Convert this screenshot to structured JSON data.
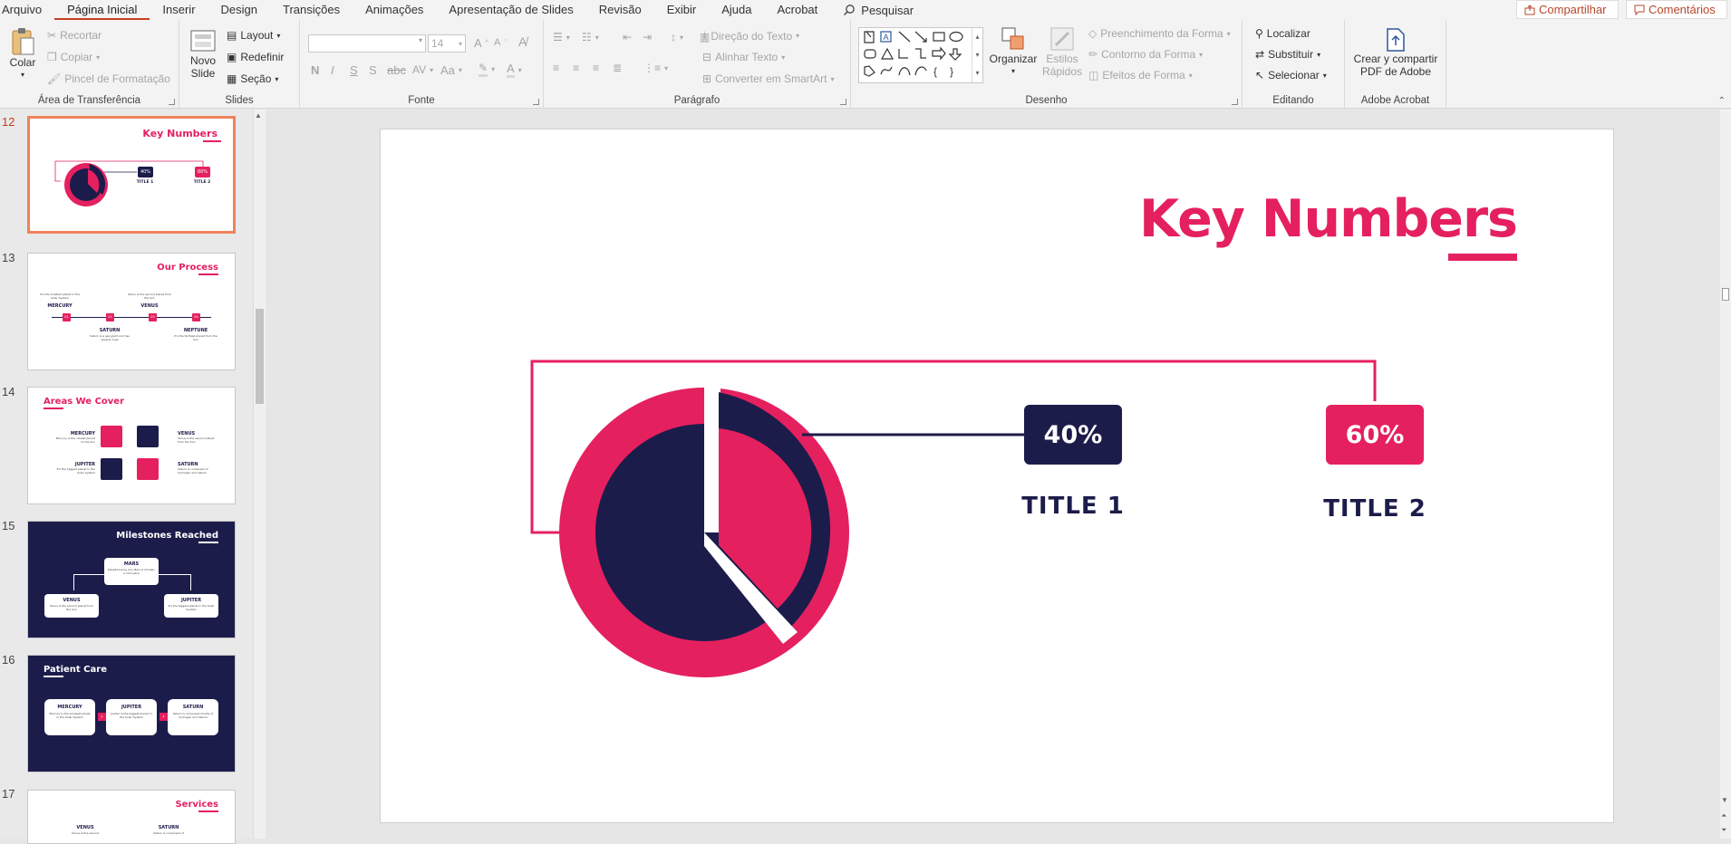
{
  "menu": {
    "tabs": [
      "Arquivo",
      "Página Inicial",
      "Inserir",
      "Design",
      "Transições",
      "Animações",
      "Apresentação de Slides",
      "Revisão",
      "Exibir",
      "Ajuda",
      "Acrobat"
    ],
    "active_index": 1,
    "search_label": "Pesquisar",
    "share_label": "Compartilhar",
    "comments_label": "Comentários"
  },
  "ribbon": {
    "clipboard": {
      "paste": "Colar",
      "cut": "Recortar",
      "copy": "Copiar",
      "format_painter": "Pincel de Formatação",
      "label": "Área de Transferência"
    },
    "slides": {
      "new_slide_1": "Novo",
      "new_slide_2": "Slide",
      "layout": "Layout",
      "reset": "Redefinir",
      "section": "Seção",
      "label": "Slides"
    },
    "font": {
      "font_name": "",
      "font_size": "14",
      "bold": "N",
      "italic": "I",
      "underline": "S",
      "strike": "S",
      "spacing": "AV",
      "case": "Aa",
      "grow": "A",
      "shrink": "A",
      "label": "Fonte"
    },
    "paragraph": {
      "text_direction": "Direção do Texto",
      "align_text": "Alinhar Texto",
      "smartart": "Converter em SmartArt",
      "label": "Parágrafo"
    },
    "drawing": {
      "arrange": "Organizar",
      "quick_styles_1": "Estilos",
      "quick_styles_2": "Rápidos",
      "shape_fill": "Preenchimento da Forma",
      "shape_outline": "Contorno da Forma",
      "shape_effects": "Efeitos de Forma",
      "label": "Desenho"
    },
    "editing": {
      "find": "Localizar",
      "replace": "Substituir",
      "select": "Selecionar",
      "label": "Editando"
    },
    "acrobat": {
      "create_1": "Crear y compartir",
      "create_2": "PDF de Adobe",
      "label": "Adobe Acrobat"
    }
  },
  "thumbnails": [
    {
      "num": "12",
      "title": "Key Numbers",
      "pct1": "40%",
      "pct2": "60%",
      "t1": "TITLE 1",
      "t2": "TITLE 2"
    },
    {
      "num": "13",
      "title": "Our Process",
      "items": [
        "MERCURY",
        "VENUS",
        "SATURN",
        "NEPTUNE"
      ],
      "steps": [
        "01",
        "02",
        "03",
        "04"
      ],
      "texts": [
        "It's the smallest planet in the Solar System",
        "Venus is the second planet from the Sun",
        "Saturn is a gas giant and has several rings",
        "It's the farthest planet from the Sun"
      ]
    },
    {
      "num": "14",
      "title": "Areas We Cover",
      "items": [
        "MERCURY",
        "VENUS",
        "JUPITER",
        "SATURN"
      ],
      "texts": [
        "Mercury is the closest planet to the Sun",
        "Venus is the second planet from the Sun",
        "It's the biggest planet in the Solar System",
        "Saturn is composed of hydrogen and helium"
      ]
    },
    {
      "num": "15",
      "title": "Milestones Reached",
      "items": [
        "MARS",
        "VENUS",
        "JUPITER"
      ],
      "texts": [
        "Despite being red, Mars is actually a cold place",
        "Venus is the second planet from the Sun",
        "It's the biggest planet in the Solar System"
      ]
    },
    {
      "num": "16",
      "title": "Patient Care",
      "items": [
        "MERCURY",
        "JUPITER",
        "SATURN"
      ],
      "texts": [
        "Mercury is the smallest planet in the Solar System",
        "Jupiter is the biggest planet in the Solar System",
        "Saturn is composed mostly of hydrogen and helium"
      ]
    },
    {
      "num": "17",
      "title": "Services",
      "items": [
        "VENUS",
        "SATURN"
      ],
      "texts": [
        "Venus is the second",
        "Saturn is composed of"
      ]
    }
  ],
  "slide": {
    "title": "Key Numbers",
    "badge1": "40%",
    "badge2": "60%",
    "title1": "TITLE 1",
    "title2": "TITLE 2"
  },
  "colors": {
    "pink": "#e5205f",
    "navy": "#1c1c4b"
  }
}
